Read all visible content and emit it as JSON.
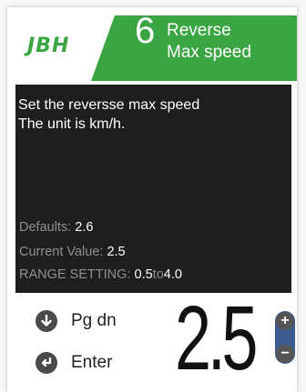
{
  "header": {
    "logo": "JBH",
    "param_number": "6",
    "param_title": "Reverse\nMax speed"
  },
  "info": {
    "line1": "Set the reversse max speed",
    "line2": "The unit is km/h.",
    "defaults_label": "Defaults:",
    "defaults_value": "2.6",
    "current_label": "Current Value:",
    "current_value": "2.5",
    "range_label": "RANGE SETTING:",
    "range_min": "0.5",
    "range_to": "to",
    "range_max": "4.0"
  },
  "controls": {
    "pgdn_label": "Pg dn",
    "enter_label": "Enter",
    "plus_symbol": "+",
    "minus_symbol": "−"
  },
  "value_display": "2.5",
  "colors": {
    "brand_green": "#3aa542",
    "info_bg": "#1e1e1e",
    "stepper_blue": "#3d5a8f"
  },
  "icons": {
    "pgdn": "arrow-down-circle-icon",
    "enter": "enter-return-icon"
  }
}
